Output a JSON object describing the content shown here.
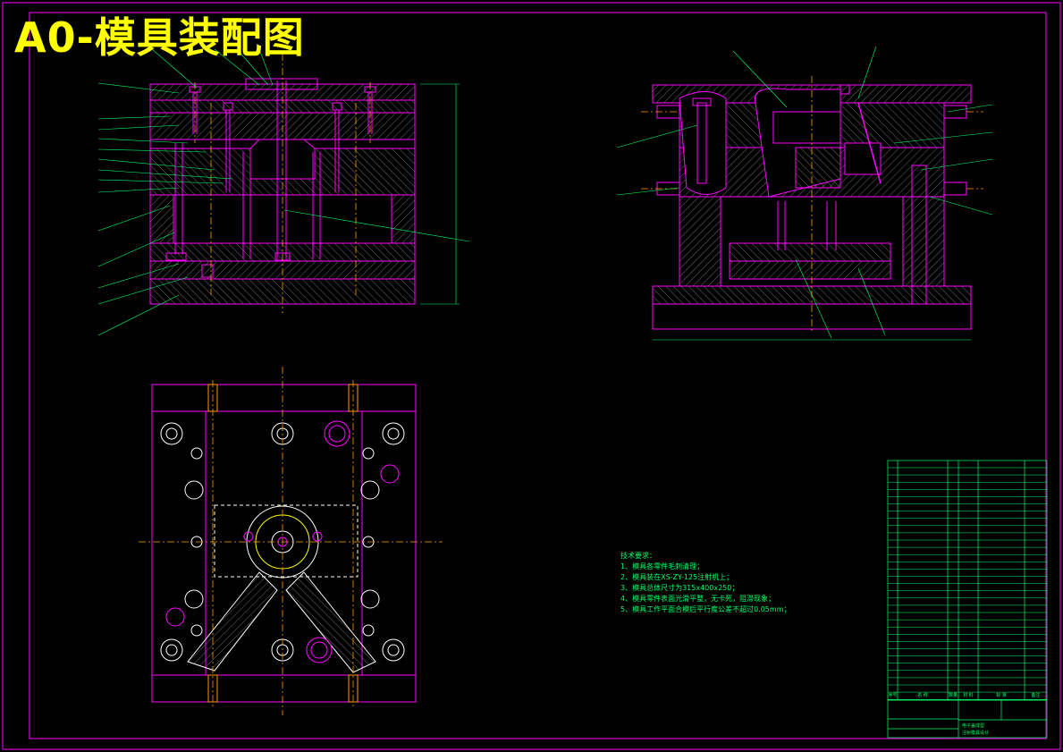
{
  "title": "A0-模具装配图",
  "notes": {
    "heading": "技术要求：",
    "items": [
      "1、模具各零件毛刺清理；",
      "2、模具装在XS-ZY-125注射机上；",
      "3、模具总体尺寸为315x400x250；",
      "4、模具零件表面光滑平整，无卡死，阻滞现象；",
      "5、模具工作平面合模后平行度公差不超过0.05mm；"
    ]
  },
  "title_block": {
    "drawing_name_line1": "电子盖成型",
    "drawing_name_line2": "注射模具设计",
    "header_cols": [
      "序号",
      "名  称",
      "数量",
      "材  料",
      "标  准",
      "备注"
    ]
  },
  "colors": {
    "frame": "#ff00ff",
    "outline": "#ff00ff",
    "hatch": "#ffffff",
    "center": "#ff9900",
    "leader": "#00ff66",
    "title": "#ffff00"
  }
}
